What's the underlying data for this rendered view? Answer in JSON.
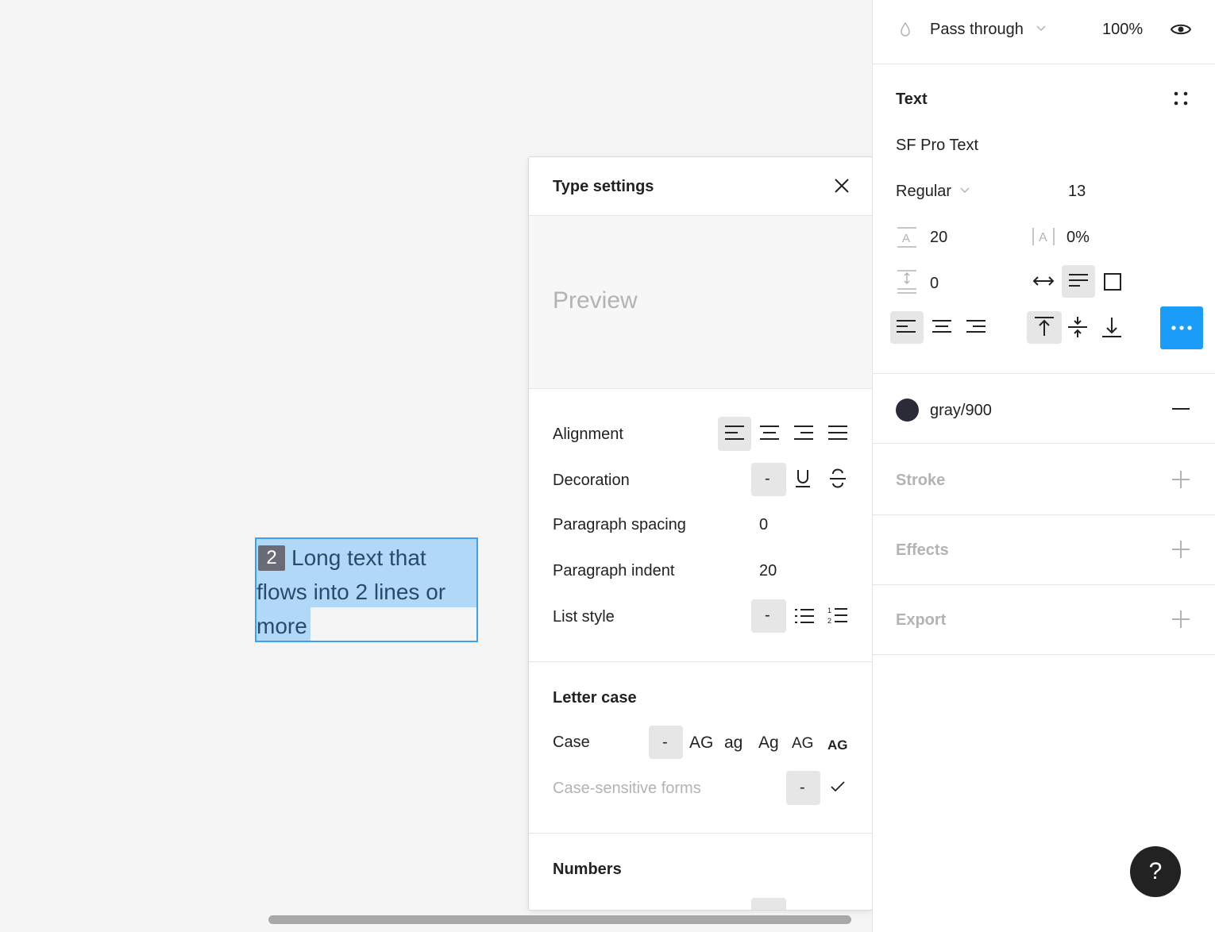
{
  "canvas": {
    "text_box": {
      "badge": "2",
      "line1": "Long text that",
      "line2": "flows into 2 lines or",
      "line3": "more"
    }
  },
  "type_settings": {
    "title": "Type settings",
    "preview": "Preview",
    "rows": {
      "alignment": "Alignment",
      "decoration": "Decoration",
      "paragraph_spacing": "Paragraph spacing",
      "paragraph_spacing_value": "0",
      "paragraph_indent": "Paragraph indent",
      "paragraph_indent_value": "20",
      "list_style": "List style",
      "none": "-"
    },
    "letter_case": {
      "heading": "Letter case",
      "case": "Case",
      "case_options": [
        "-",
        "AG",
        "ag",
        "Ag",
        "AG",
        "AG"
      ],
      "case_sensitive": "Case-sensitive forms",
      "cs_none": "-"
    },
    "numbers": {
      "heading": "Numbers"
    }
  },
  "panel": {
    "layer": {
      "blend": "Pass through",
      "opacity": "100%"
    },
    "text": {
      "heading": "Text",
      "font": "SF Pro Text",
      "weight": "Regular",
      "size": "13",
      "line_height": "20",
      "letter_spacing": "0%",
      "paragraph_spacing": "0"
    },
    "fill": {
      "name": "gray/900",
      "color": "#2b2b38"
    },
    "stroke": "Stroke",
    "effects": "Effects",
    "export": "Export"
  },
  "help": "?",
  "colors": {
    "accent": "#1b9cf8",
    "selection": "#39a0f2"
  }
}
